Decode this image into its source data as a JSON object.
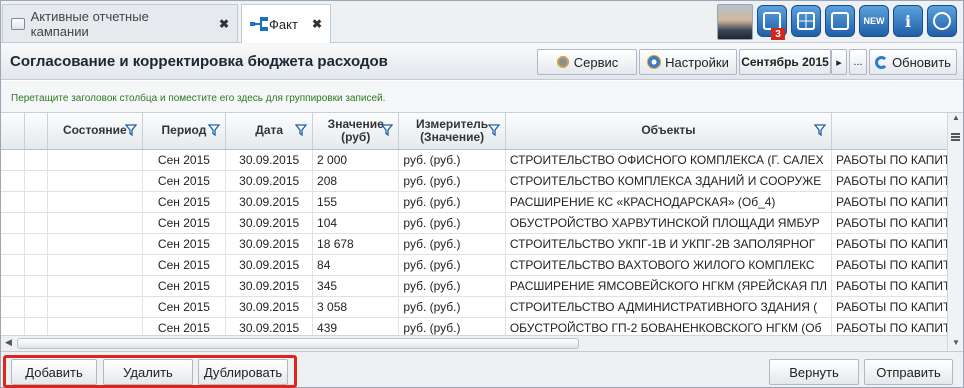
{
  "tabs": [
    {
      "label": "Активные отчетные кампании",
      "close": "✖"
    },
    {
      "label": "Факт",
      "close": "✖"
    }
  ],
  "toolbar": {
    "notification_count": "3",
    "news_label": "NEW",
    "info_label": "i"
  },
  "header": {
    "title": "Согласование и корректировка бюджета расходов",
    "service_label": "Сервис",
    "settings_label": "Настройки",
    "period_value": "Сентябрь 2015",
    "next_arrow": "▸",
    "more_label": "...",
    "refresh_label": "Обновить"
  },
  "group_hint": "Перетащите заголовок столбца и поместите его здесь для группировки записей.",
  "grid": {
    "columns": [
      "Состояние",
      "Период",
      "Дата",
      "Значение (руб)",
      "Измеритель (Значение)",
      "Объекты",
      ""
    ],
    "rows": [
      [
        "",
        "Сен 2015",
        "30.09.2015",
        "2 000",
        "руб. (руб.)",
        "СТРОИТЕЛЬСТВО ОФИСНОГО КОМПЛЕКСА (Г. САЛЕХ",
        "РАБОТЫ ПО КАПИТА"
      ],
      [
        "",
        "Сен 2015",
        "30.09.2015",
        "208",
        "руб. (руб.)",
        "СТРОИТЕЛЬСТВО КОМПЛЕКСА ЗДАНИЙ И СООРУЖЕ",
        "РАБОТЫ ПО КАПИТА"
      ],
      [
        "",
        "Сен 2015",
        "30.09.2015",
        "155",
        "руб. (руб.)",
        "РАСШИРЕНИЕ КС «КРАСНОДАРСКАЯ» (Об_4)",
        "РАБОТЫ ПО КАПИТА"
      ],
      [
        "",
        "Сен 2015",
        "30.09.2015",
        "104",
        "руб. (руб.)",
        "ОБУСТРОЙСТВО ХАРВУТИНСКОЙ ПЛОЩАДИ ЯМБУР",
        "РАБОТЫ ПО КАПИТА"
      ],
      [
        "",
        "Сен 2015",
        "30.09.2015",
        "18 678",
        "руб. (руб.)",
        "СТРОИТЕЛЬСТВО УКПГ-1В И УКПГ-2В ЗАПОЛЯРНОГ",
        "РАБОТЫ ПО КАПИТА"
      ],
      [
        "",
        "Сен 2015",
        "30.09.2015",
        "84",
        "руб. (руб.)",
        "СТРОИТЕЛЬСТВО ВАХТОВОГО ЖИЛОГО КОМПЛЕКС",
        "РАБОТЫ ПО КАПИТА"
      ],
      [
        "",
        "Сен 2015",
        "30.09.2015",
        "345",
        "руб. (руб.)",
        "РАСШИРЕНИЕ ЯМСОВЕЙСКОГО НГКМ (ЯРЕЙСКАЯ ПЛ",
        "РАБОТЫ ПО КАПИТА"
      ],
      [
        "",
        "Сен 2015",
        "30.09.2015",
        "3 058",
        "руб. (руб.)",
        "СТРОИТЕЛЬСТВО АДМИНИСТРАТИВНОГО ЗДАНИЯ (",
        "РАБОТЫ ПО КАПИТА"
      ],
      [
        "",
        "Сен 2015",
        "30.09.2015",
        "439",
        "руб. (руб.)",
        "ОБУСТРОЙСТВО ГП-2 БОВАНЕНКОВСКОГО НГКМ (Об",
        "РАБОТЫ ПО КАПИТА"
      ]
    ]
  },
  "footer": {
    "add_label": "Добавить",
    "delete_label": "Удалить",
    "duplicate_label": "Дублировать",
    "return_label": "Вернуть",
    "send_label": "Отправить"
  },
  "colors": {
    "accent": "#1f5fa8",
    "highlight_box": "#e0231b",
    "hint_text": "#2d7a1e"
  }
}
